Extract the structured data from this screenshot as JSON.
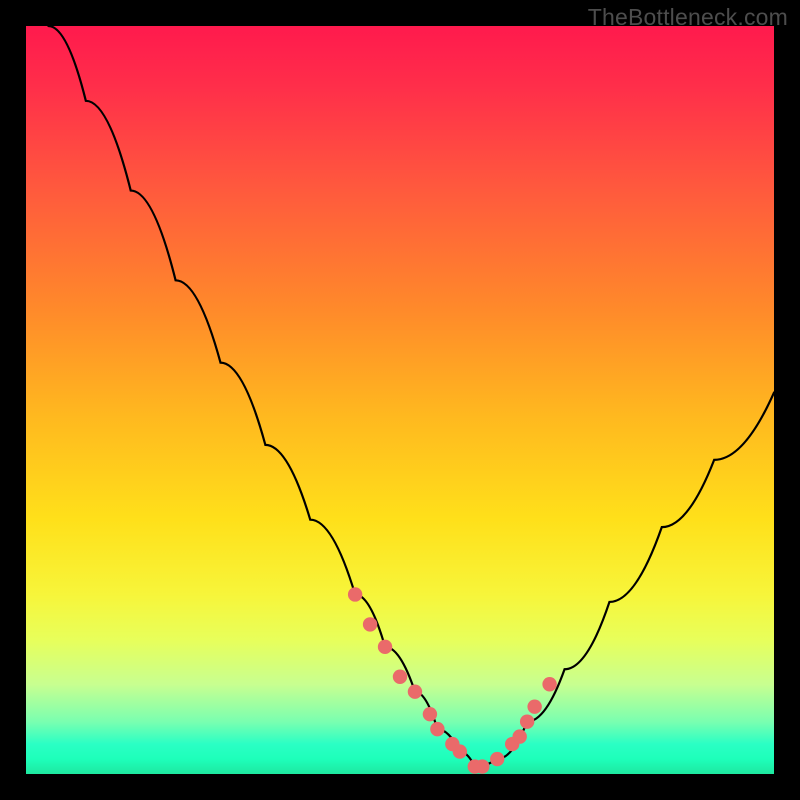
{
  "watermark": "TheBottleneck.com",
  "chart_data": {
    "type": "line",
    "title": "",
    "xlabel": "",
    "ylabel": "",
    "xlim": [
      0,
      100
    ],
    "ylim": [
      0,
      100
    ],
    "series": [
      {
        "name": "bottleneck-curve",
        "x": [
          3,
          8,
          14,
          20,
          26,
          32,
          38,
          44,
          48,
          52,
          55,
          58,
          60,
          63,
          67,
          72,
          78,
          85,
          92,
          100
        ],
        "y": [
          100,
          90,
          78,
          66,
          55,
          44,
          34,
          24,
          17,
          11,
          6,
          3,
          1,
          2,
          7,
          14,
          23,
          33,
          42,
          51
        ],
        "color": "#000000"
      },
      {
        "name": "highlight-points",
        "x": [
          44,
          46,
          48,
          50,
          52,
          54,
          55,
          57,
          58,
          60,
          61,
          63,
          65,
          66,
          67,
          68,
          70
        ],
        "y": [
          24,
          20,
          17,
          13,
          11,
          8,
          6,
          4,
          3,
          1,
          1,
          2,
          4,
          5,
          7,
          9,
          12
        ],
        "color": "#ea6a6a"
      }
    ]
  }
}
